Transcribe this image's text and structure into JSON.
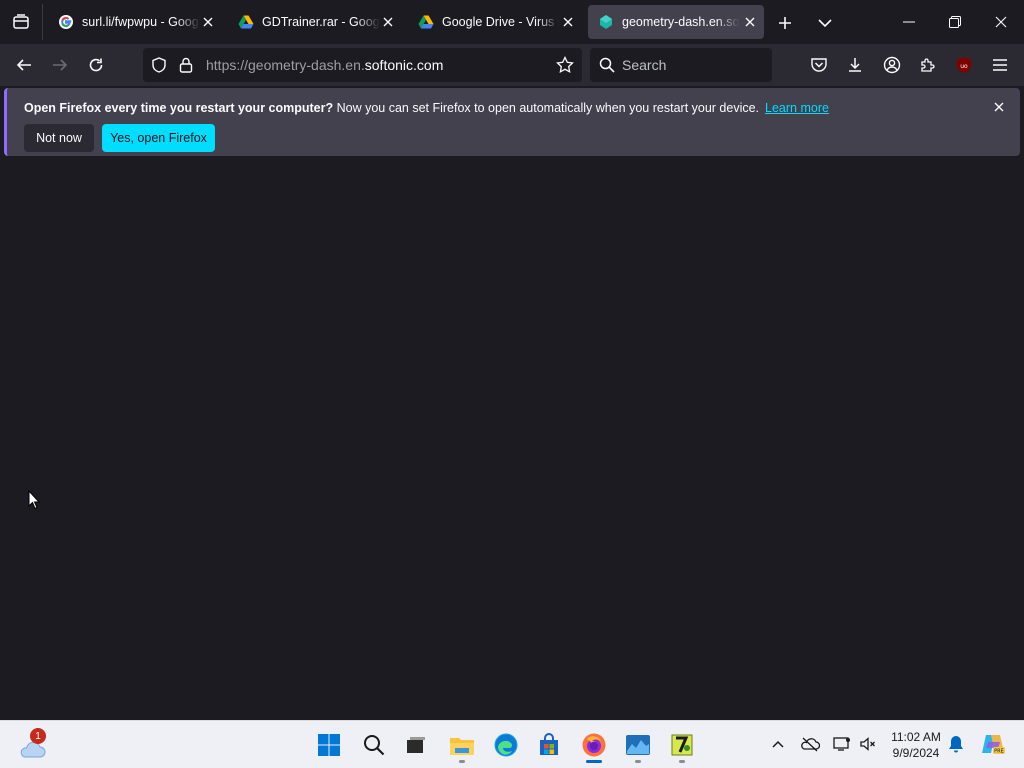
{
  "tabs": [
    {
      "title": "surl.li/fwpwpu - Google",
      "favicon": "google-icon",
      "active": false
    },
    {
      "title": "GDTrainer.rar - Google D",
      "favicon": "google-drive-icon",
      "active": false
    },
    {
      "title": "Google Drive - Virus sca",
      "favicon": "google-drive-icon",
      "active": false
    },
    {
      "title": "geometry-dash.en.softonic",
      "favicon": "softonic-icon",
      "active": true
    }
  ],
  "navbar": {
    "url_prefix": "https://geometry-dash.en.",
    "url_domain": "softonic.com",
    "search_placeholder": "Search"
  },
  "notification": {
    "bold_text": "Open Firefox every time you restart your computer?",
    "text": " Now you can set Firefox to open automatically when you restart your device.",
    "link": "Learn more",
    "btn_secondary": "Not now",
    "btn_primary": "Yes, open Firefox"
  },
  "taskbar": {
    "weather_badge": "1",
    "time": "11:02 AM",
    "date": "9/9/2024",
    "apps": [
      "windows-start-icon",
      "search-icon",
      "task-view-icon",
      "file-explorer-icon",
      "edge-icon",
      "store-icon",
      "firefox-icon",
      "app-icon",
      "7zip-icon"
    ]
  },
  "colors": {
    "accent": "#00ddff",
    "tab_active": "#42414d",
    "toolbar": "#2b2a33",
    "background": "#1c1b22"
  }
}
